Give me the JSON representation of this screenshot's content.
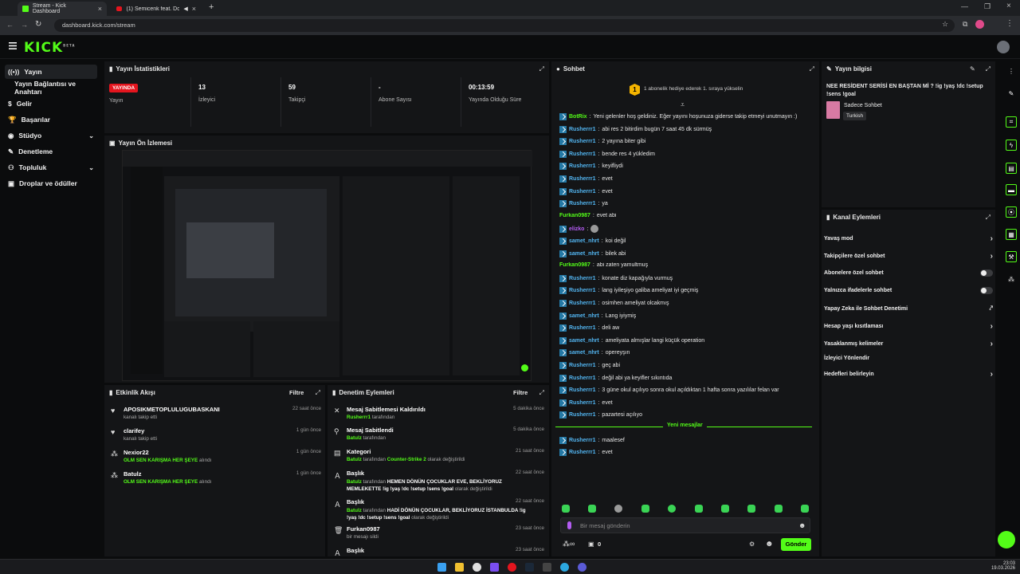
{
  "browser": {
    "tabs": [
      {
        "label": "Stream - Kick Dashboard"
      },
      {
        "label": "(1) Semicenk feat. Doğu Sw..."
      }
    ],
    "url": "dashboard.kick.com/stream"
  },
  "header": {
    "logo": "KICK",
    "logo_sup": "BETA"
  },
  "sidebar": {
    "items": [
      {
        "label": "Yayın"
      },
      {
        "label": "Yayın Bağlantısı ve Anahtarı"
      },
      {
        "label": "Gelir"
      },
      {
        "label": "Başarılar"
      },
      {
        "label": "Stüdyo"
      },
      {
        "label": "Denetleme"
      },
      {
        "label": "Topluluk"
      },
      {
        "label": "Droplar ve ödüller"
      }
    ]
  },
  "stats": {
    "title": "Yayın İstatistikleri",
    "live_badge": "YAYINDA",
    "live_label": "Yayın",
    "viewers_value": "13",
    "viewers_label": "İzleyici",
    "followers_value": "59",
    "followers_label": "Takipçi",
    "subs_value": "-",
    "subs_label": "Abone Sayısı",
    "uptime_value": "00:13:59",
    "uptime_label": "Yayında Olduğu Süre"
  },
  "preview": {
    "title": "Yayın Ön İzlemesi"
  },
  "activity": {
    "title": "Etkinlik Akışı",
    "filter": "Filtre",
    "items": [
      {
        "name": "APOSIKMETOPLULUGUBASKANI",
        "sub": "kanalı takip etti",
        "time": "22 saat önce"
      },
      {
        "name": "clarifey",
        "sub": "kanalı takip etti",
        "time": "1 gün önce"
      },
      {
        "name": "Nexior22",
        "green": "OLM SEN KARIŞMA HER ŞEYE",
        "sub": "alındı",
        "time": "1 gün önce"
      },
      {
        "name": "Batulz",
        "green": "OLM SEN KARIŞMA HER ŞEYE",
        "sub": "alındı",
        "time": "1 gün önce"
      }
    ]
  },
  "moderation": {
    "title": "Denetim Eylemleri",
    "filter": "Filtre",
    "items": [
      {
        "name": "Mesaj Sabitlemesi Kaldırıldı",
        "user": "Rusherrr1",
        "sub": "tarafından",
        "time": "5 dakika önce"
      },
      {
        "name": "Mesaj Sabitlendi",
        "user": "Batulz",
        "sub": "tarafından",
        "time": "5 dakika önce"
      },
      {
        "name": "Kategori",
        "user": "Batulz",
        "sub": "tarafından",
        "extra": "Counter-Strike 2",
        "tail": "olarak değiştirildi",
        "time": "21 saat önce"
      },
      {
        "name": "Başlık",
        "user": "Batulz",
        "sub": "tarafından",
        "extra": "HEMEN DÖNÜN ÇOCUKLAR EVE, BEKLİYORUZ MEMLEKETTE !ig !yaş !dc !setup !sens !goal",
        "tail": "olarak değiştirildi",
        "time": "22 saat önce"
      },
      {
        "name": "Başlık",
        "user": "Batulz",
        "sub": "tarafından",
        "extra": "HADİ DÖNÜN ÇOCUKLAR, BEKLİYORUZ İSTANBULDA !ig !yaş !dc !setup !sens !goal",
        "tail": "olarak değiştirildi",
        "time": "22 saat önce"
      },
      {
        "name": "Furkan0987",
        "sub": "bir mesajı sildi",
        "time": "23 saat önce"
      },
      {
        "name": "Başlık",
        "time": "23 saat önce"
      }
    ]
  },
  "chat": {
    "title": "Sohbet",
    "pinned": "1 abonelik hediye ederek 1. sıraya yükselin",
    "pinned_rank": "1",
    "lines": [
      {
        "user": "BotRix",
        "color": "green",
        "badge": true,
        "text": "Yeni gelenler hoş geldiniz. Eğer yayını hoşunuza giderse takip etmeyi unutmayın :)"
      },
      {
        "user": "Rusherrr1",
        "color": "blue",
        "badge": true,
        "text": "abi res 2 bitirdim bugün 7 saat 45 dk sürmüş"
      },
      {
        "user": "Rusherrr1",
        "color": "blue",
        "badge": true,
        "text": "2 yayına biter gibi"
      },
      {
        "user": "Rusherrr1",
        "color": "blue",
        "badge": true,
        "text": "bende res 4 yükledim"
      },
      {
        "user": "Rusherrr1",
        "color": "blue",
        "badge": true,
        "text": "keyifliydi"
      },
      {
        "user": "Rusherrr1",
        "color": "blue",
        "badge": true,
        "text": "evet"
      },
      {
        "user": "Rusherrr1",
        "color": "blue",
        "badge": true,
        "text": "evet"
      },
      {
        "user": "Rusherrr1",
        "color": "blue",
        "badge": true,
        "text": "ya"
      },
      {
        "user": "Furkan0987",
        "color": "green",
        "badge": false,
        "text": "evet abi"
      },
      {
        "user": "elizko",
        "color": "purple",
        "badge": true,
        "text": ""
      },
      {
        "user": "samet_nhrt",
        "color": "blue",
        "badge": true,
        "text": "koi değil"
      },
      {
        "user": "samet_nhrt",
        "color": "blue",
        "badge": true,
        "text": "bilek abi"
      },
      {
        "user": "Furkan0987",
        "color": "green",
        "badge": false,
        "text": "abi zaten yamultmuş"
      },
      {
        "user": "Rusherrr1",
        "color": "blue",
        "badge": true,
        "text": "konate diz kapağıyla vurmuş"
      },
      {
        "user": "Rusherrr1",
        "color": "blue",
        "badge": true,
        "text": "lang iyileşiyo galiba ameliyat iyi geçmiş"
      },
      {
        "user": "Rusherrr1",
        "color": "blue",
        "badge": true,
        "text": "osimhen ameliyat olcakmış"
      },
      {
        "user": "samet_nhrt",
        "color": "blue",
        "badge": true,
        "text": "Lang iyiymiş"
      },
      {
        "user": "Rusherrr1",
        "color": "blue",
        "badge": true,
        "text": "deli aw"
      },
      {
        "user": "samet_nhrt",
        "color": "blue",
        "badge": true,
        "text": "ameliyata almışlar langi küçük operation"
      },
      {
        "user": "samet_nhrt",
        "color": "blue",
        "badge": true,
        "text": "opereyşın"
      },
      {
        "user": "Rusherrr1",
        "color": "blue",
        "badge": true,
        "text": "geç abi"
      },
      {
        "user": "Rusherrr1",
        "color": "blue",
        "badge": true,
        "text": "değil abi ya keyifler sıkıntıda"
      },
      {
        "user": "Rusherrr1",
        "color": "blue",
        "badge": true,
        "text": "3 güne okul açılıyo sonra okul açıldıktan 1 hafta sonra yazılılar felan var"
      },
      {
        "user": "Rusherrr1",
        "color": "blue",
        "badge": true,
        "text": "evet"
      },
      {
        "user": "Rusherrr1",
        "color": "blue",
        "badge": true,
        "text": "pazartesi açılıyo"
      }
    ],
    "new_messages": "Yeni mesajlar",
    "new_lines": [
      {
        "user": "Rusherrr1",
        "text": "maalesef"
      },
      {
        "user": "Rusherrr1",
        "text": "evet"
      }
    ],
    "input_placeholder": "Bir mesaj gönderin",
    "points": "0",
    "send": "Gönder"
  },
  "stream_info": {
    "title": "Yayın bilgisi",
    "stream_title": "NEE RESİDENT SERİSİ EN BAŞTAN Mİ ? !ig !yaş !dc !setup !sens !goal",
    "category": "Sadece Sohbet",
    "language": "Turkish"
  },
  "channel_actions": {
    "title": "Kanal Eylemleri",
    "items": [
      {
        "label": "Yavaş mod",
        "kind": "chevron"
      },
      {
        "label": "Takipçilere özel sohbet",
        "kind": "chevron"
      },
      {
        "label": "Abonelere özel sohbet",
        "kind": "toggle"
      },
      {
        "label": "Yalnızca ifadelerle sohbet",
        "kind": "toggle"
      },
      {
        "label": "Yapay Zeka ile Sohbet Denetimi",
        "kind": "external"
      },
      {
        "label": "Hesap yaşı kısıtlaması",
        "kind": "chevron"
      },
      {
        "label": "Yasaklanmış kelimeler",
        "kind": "chevron"
      },
      {
        "label": "İzleyici Yönlendir",
        "kind": "none"
      },
      {
        "label": "Hedefleri belirleyin",
        "kind": "chevron"
      }
    ]
  },
  "taskbar": {
    "time": "23:03",
    "date": "19.03.2026"
  },
  "colors": {
    "accent": "#53fc18",
    "live": "#e4151e",
    "user_blue": "#52b5f1",
    "user_purple": "#b35cf2"
  }
}
